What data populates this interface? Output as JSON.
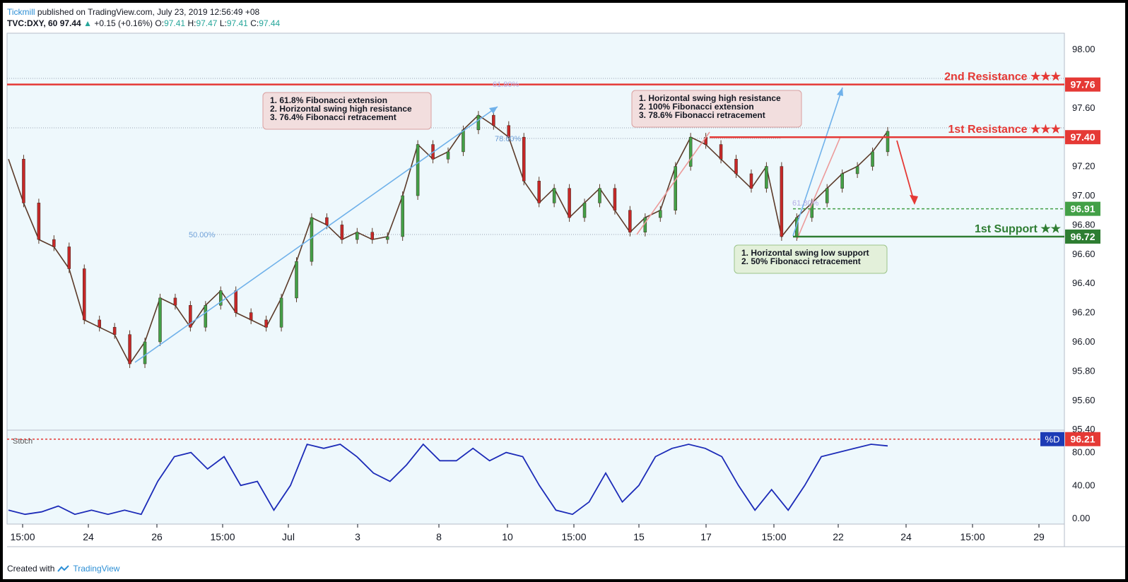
{
  "header": {
    "publisher": "Tickmill",
    "published_text": "published on TradingView.com, July 23, 2019 12:56:49 +08",
    "symbol": "TVC:DXY, 60",
    "last": "97.44",
    "change_arrow": "▲",
    "change": "+0.15 (+0.16%)",
    "o_label": "O:",
    "o": "97.41",
    "h_label": "H:",
    "h": "97.47",
    "l_label": "L:",
    "l": "97.41",
    "c_label": "C:",
    "c": "97.44"
  },
  "footer": {
    "created_with": "Created with",
    "brand": "TradingView"
  },
  "levels": [
    {
      "label": "2nd Resistance ★★★",
      "value": 97.76,
      "tag": "97.76",
      "color": "#e53935",
      "style": "solid"
    },
    {
      "label": "1st Resistance ★★★",
      "value": 97.4,
      "tag": "97.40",
      "color": "#e53935",
      "style": "solid"
    },
    {
      "label": "",
      "value": 96.91,
      "tag": "96.91",
      "color": "#43a047",
      "style": "dashed"
    },
    {
      "label": "1st Support ★★",
      "value": 96.72,
      "tag": "96.72",
      "color": "#2e7d32",
      "style": "solid"
    }
  ],
  "annotations": [
    {
      "lines": [
        "1. 61.8% Fibonacci extension",
        "2. Horizontal swing high resistance",
        "3. 76.4% Fibonacci retracement"
      ],
      "bg": "#f2dede",
      "border": "#d9a0a0"
    },
    {
      "lines": [
        "1. Horizontal swing high resistance",
        "2. 100% Fibonacci extension",
        "3. 78.6% Fibonacci retracement"
      ],
      "bg": "#f2dede",
      "border": "#d9a0a0"
    },
    {
      "lines": [
        "1. Horizontal swing low support",
        "2. 50% Fibonacci retracement"
      ],
      "bg": "#e3f0da",
      "border": "#9cc48a"
    }
  ],
  "fib_labels": [
    "61.80%",
    "78.60%",
    "50.00%",
    "61.80%"
  ],
  "stoch": {
    "name": "Stoch",
    "badge": "%D",
    "value_tag": "96.21",
    "yticks": [
      "80.00",
      "40.00",
      "0.00"
    ]
  },
  "chart_data": {
    "type": "line",
    "title": "",
    "xlabel": "",
    "ylabel": "",
    "ylim": [
      95.4,
      98.1
    ],
    "y_ticks": [
      "98.00",
      "97.76",
      "97.60",
      "97.40",
      "97.20",
      "97.00",
      "96.80",
      "96.60",
      "96.40",
      "96.20",
      "96.00",
      "95.80",
      "95.60",
      "95.40"
    ],
    "x_ticks": [
      "15:00",
      "24",
      "26",
      "15:00",
      "Jul",
      "3",
      "8",
      "10",
      "15:00",
      "15",
      "17",
      "15:00",
      "22",
      "24",
      "15:00",
      "29"
    ],
    "series": [
      {
        "values": [
          97.25,
          96.95,
          96.7,
          96.65,
          96.5,
          96.15,
          96.1,
          96.05,
          95.85,
          96.0,
          96.3,
          96.25,
          96.1,
          96.25,
          96.35,
          96.2,
          96.15,
          96.1,
          96.3,
          96.55,
          96.85,
          96.8,
          96.7,
          96.75,
          96.7,
          96.72,
          97.0,
          97.35,
          97.25,
          97.3,
          97.45,
          97.55,
          97.48,
          97.4,
          97.1,
          96.95,
          97.05,
          96.85,
          96.95,
          97.05,
          96.9,
          96.75,
          96.85,
          96.9,
          97.2,
          97.4,
          97.35,
          97.25,
          97.15,
          97.05,
          97.2,
          96.72,
          96.85,
          96.95,
          97.05,
          97.15,
          97.2,
          97.3,
          97.44
        ]
      },
      {
        "name": "Stoch %D",
        "values": [
          10,
          5,
          8,
          15,
          5,
          10,
          5,
          10,
          5,
          45,
          75,
          80,
          60,
          75,
          40,
          45,
          10,
          40,
          90,
          85,
          90,
          75,
          55,
          45,
          65,
          90,
          70,
          70,
          85,
          70,
          80,
          75,
          40,
          10,
          5,
          20,
          55,
          20,
          40,
          75,
          85,
          90,
          85,
          75,
          40,
          10,
          35,
          10,
          40,
          75,
          80,
          85,
          90,
          88
        ]
      }
    ]
  }
}
